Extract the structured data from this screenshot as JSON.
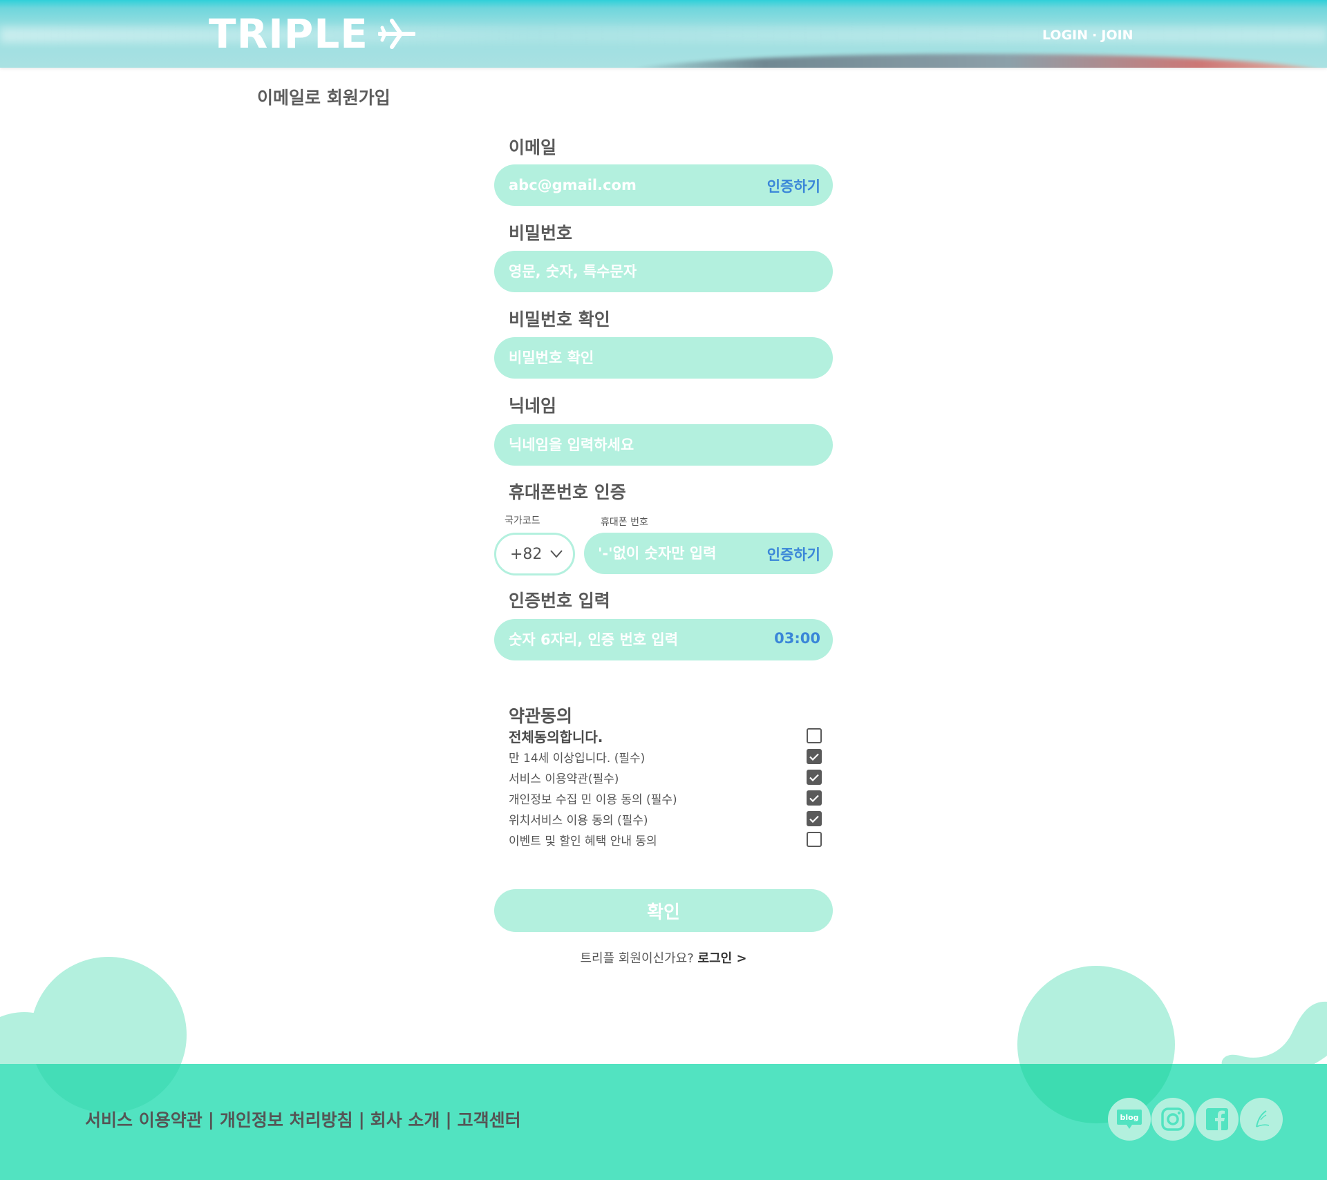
{
  "header": {
    "logo_text": "TRIPLE",
    "login_label": "LOGIN",
    "separator": "·",
    "join_label": "JOIN"
  },
  "page": {
    "title": "이메일로 회원가입"
  },
  "form": {
    "email": {
      "label": "이메일",
      "placeholder": "abc@gmail.com",
      "action": "인증하기"
    },
    "password": {
      "label": "비밀번호",
      "placeholder": "영문, 숫자, 특수문자"
    },
    "password_confirm": {
      "label": "비밀번호 확인",
      "placeholder": "비밀번호 확인"
    },
    "nickname": {
      "label": "닉네임",
      "placeholder": "닉네임을 입력하세요"
    },
    "phone": {
      "label": "휴대폰번호 인증",
      "country_code_label": "국가코드",
      "country_code_value": "+82",
      "number_label": "휴대폰 번호",
      "placeholder": "'-'없이 숫자만 입력",
      "action": "인증하기"
    },
    "verify_code": {
      "label": "인증번호 입력",
      "placeholder": "숫자 6자리, 인증 번호 입력",
      "timer": "03:00"
    }
  },
  "terms": {
    "title": "약관동의",
    "items": [
      {
        "label": "전체동의합니다.",
        "checked": false
      },
      {
        "label": "만 14세 이상입니다. (필수)",
        "checked": true
      },
      {
        "label": "서비스 이용약관(필수)",
        "checked": true
      },
      {
        "label": "개인정보 수집 민 이용 동의 (필수)",
        "checked": true
      },
      {
        "label": "위치서비스 이용 동의 (필수)",
        "checked": true
      },
      {
        "label": "이벤트 및 할인 혜택 안내 동의",
        "checked": false
      }
    ]
  },
  "confirm_label": "확인",
  "login_prompt": {
    "text": "트리플 회원이신가요?",
    "link": "로그인 >"
  },
  "footer": {
    "links": [
      "서비스 이용약관",
      "개인정보 처리방침",
      "회사 소개",
      "고객센터"
    ],
    "separator": "|",
    "social": [
      {
        "icon": "blog-icon",
        "label": "blog"
      },
      {
        "icon": "instagram-icon"
      },
      {
        "icon": "facebook-icon"
      },
      {
        "icon": "pen-icon"
      }
    ]
  },
  "colors": {
    "mint": "#b3f0de",
    "footer": "#52e3c1",
    "accent_blue": "#3a86d8",
    "text": "#555555"
  }
}
